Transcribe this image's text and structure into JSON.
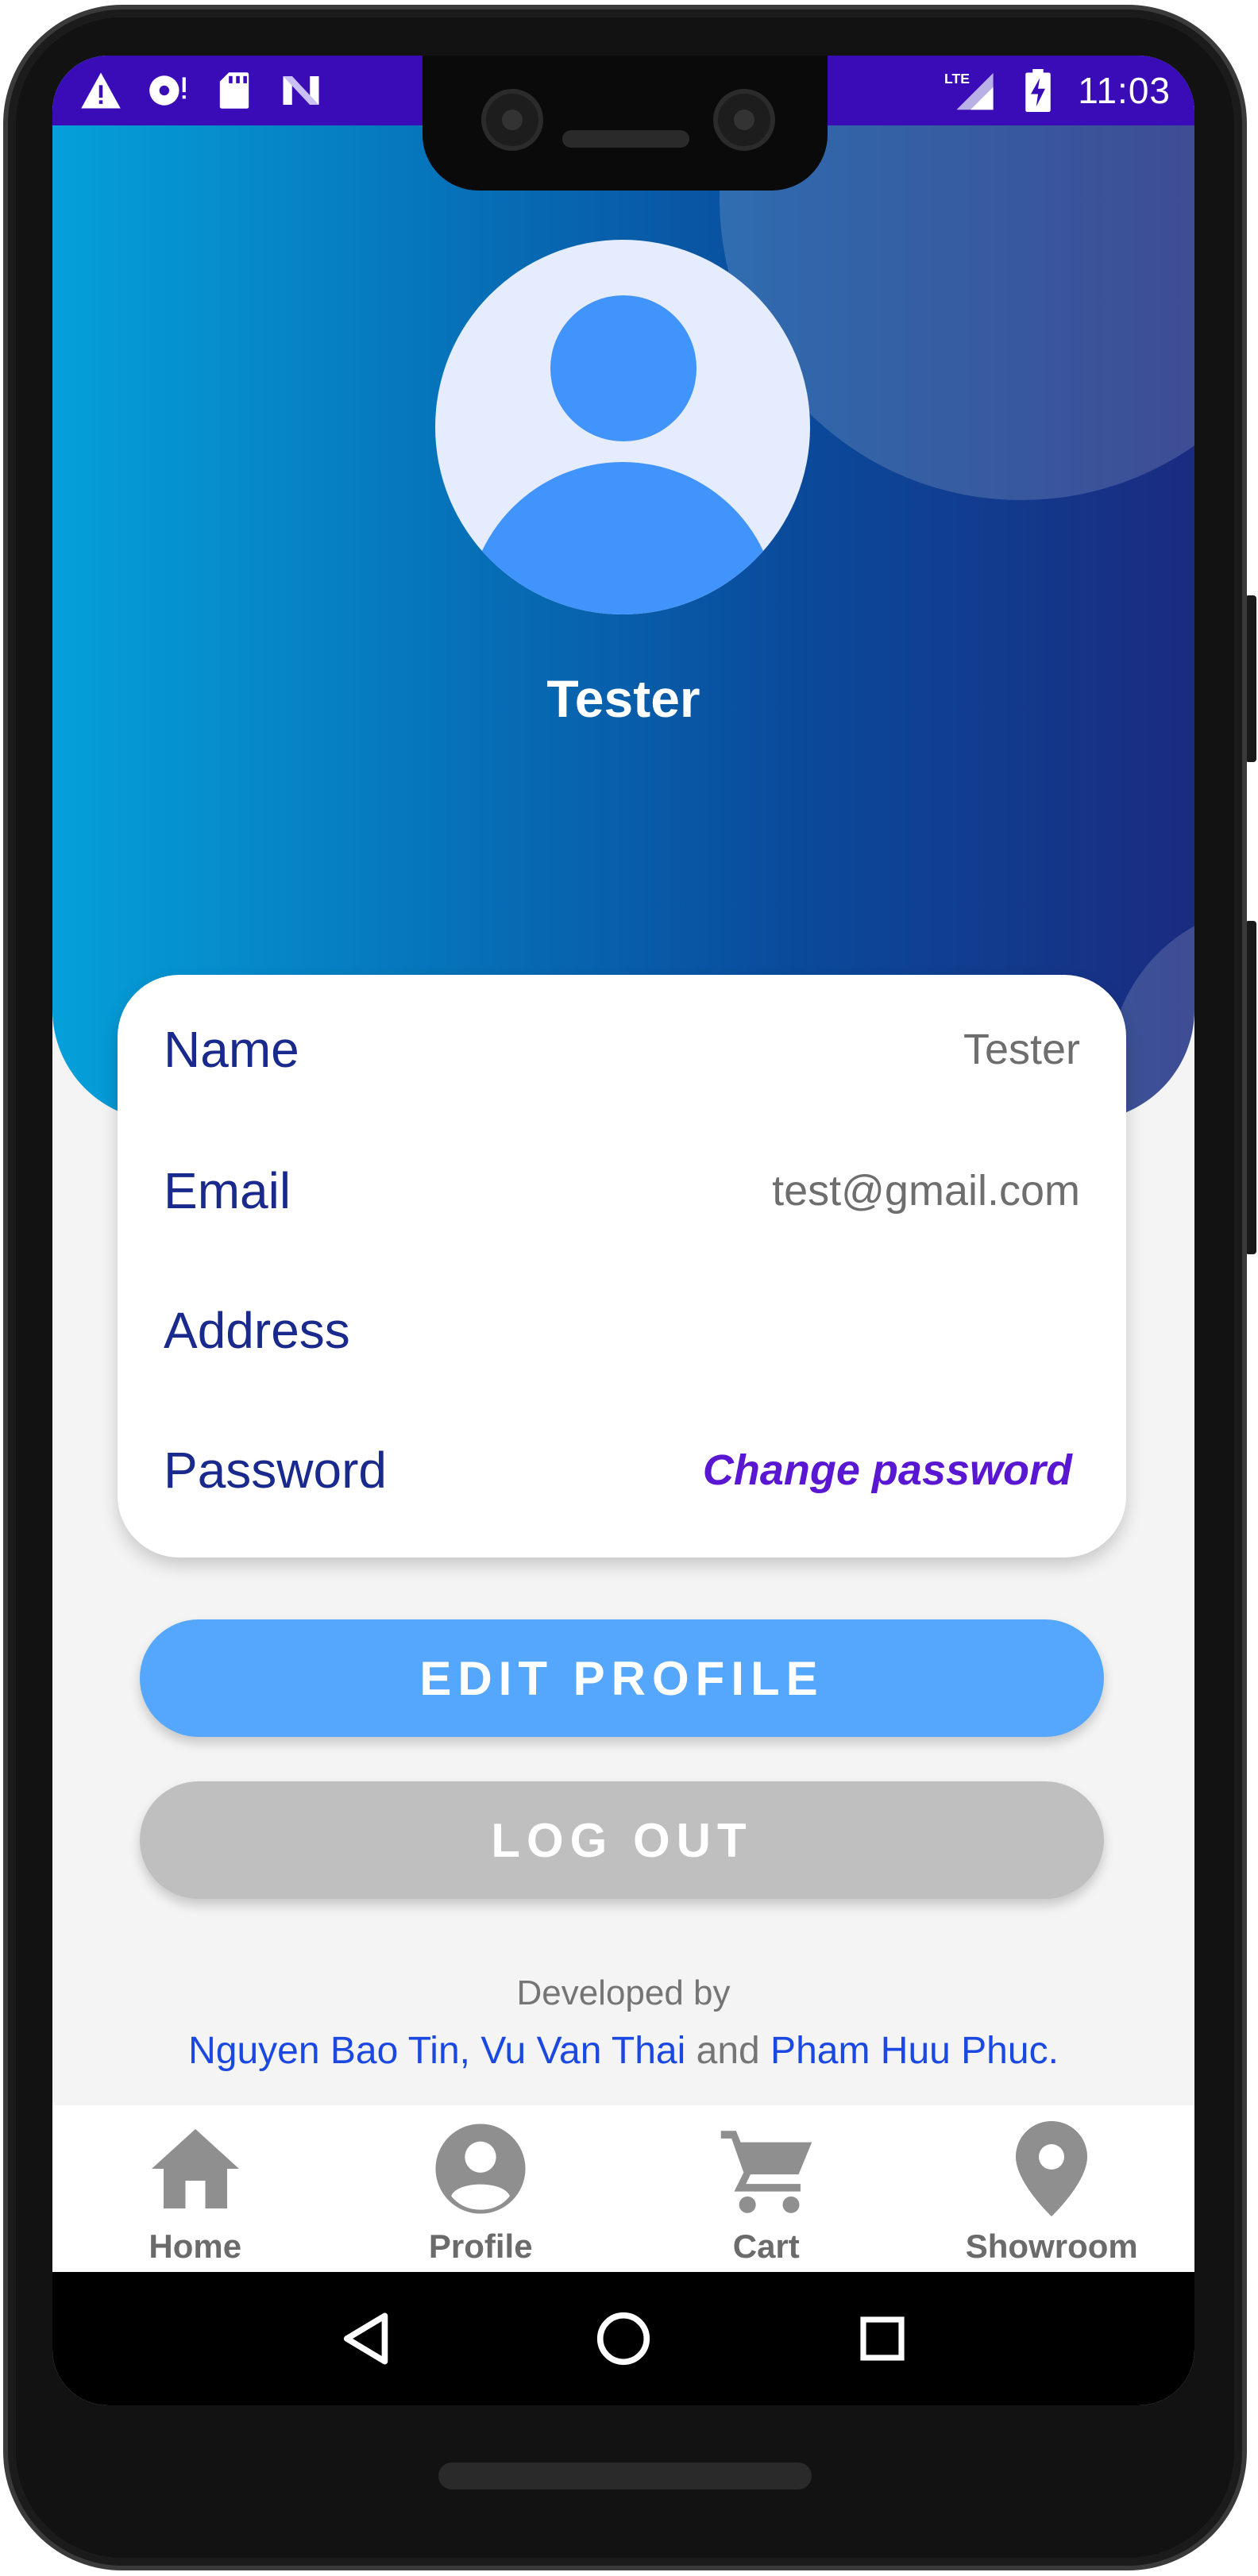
{
  "status_bar": {
    "time": "11:03",
    "network": "LTE",
    "left_icons": [
      "warning-icon",
      "disc-sync-icon",
      "sd-card-icon",
      "n-logo-icon"
    ],
    "right_icons": [
      "lte-signal-icon",
      "battery-charging-icon"
    ]
  },
  "profile": {
    "display_name": "Tester"
  },
  "info": {
    "name_label": "Name",
    "name_value": "Tester",
    "email_label": "Email",
    "email_value": "test@gmail.com",
    "address_label": "Address",
    "address_value": "",
    "password_label": "Password",
    "change_password_link": "Change password"
  },
  "actions": {
    "edit_profile": "EDIT PROFILE",
    "log_out": "LOG OUT"
  },
  "credits": {
    "developed_by": "Developed by",
    "names_part1": "Nguyen Bao Tin, Vu Van Thai",
    "connector": " and ",
    "names_part2": "Pham Huu Phuc."
  },
  "bottom_nav": {
    "items": [
      {
        "label": "Home",
        "icon": "home-icon"
      },
      {
        "label": "Profile",
        "icon": "profile-icon"
      },
      {
        "label": "Cart",
        "icon": "cart-icon"
      },
      {
        "label": "Showroom",
        "icon": "location-pin-icon"
      }
    ]
  },
  "colors": {
    "status_bar": "#3a0cb8",
    "header_start": "#05a0da",
    "header_end": "#1a2b80",
    "label_text": "#1a2a8c",
    "link_purple": "#5a17d1",
    "edit_button": "#54a7fd",
    "logout_button": "#bfbfbf",
    "credit_blue": "#1a48e0",
    "nav_icon": "#8f8f8f"
  }
}
